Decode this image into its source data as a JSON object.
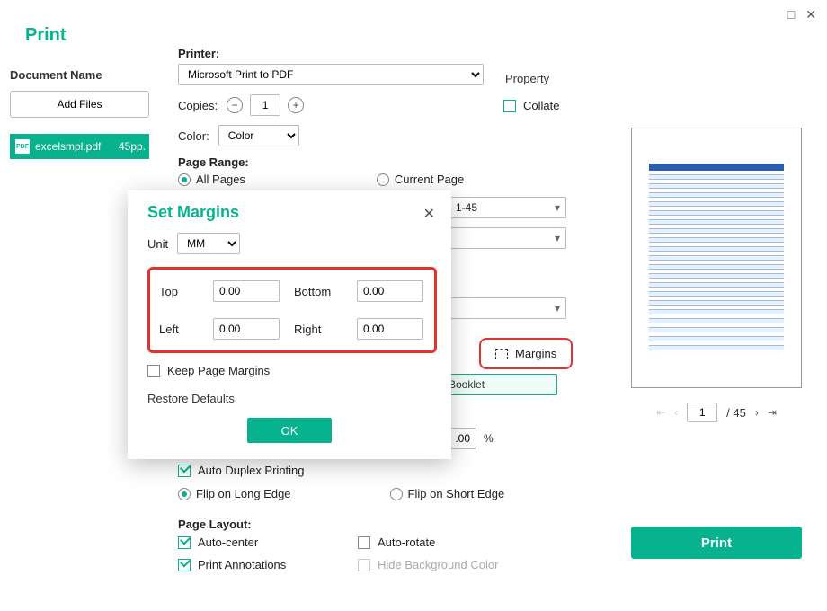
{
  "window": {
    "title": "Print",
    "maximize_glyph": "□",
    "close_glyph": "✕"
  },
  "sidebar": {
    "document_name_label": "Document Name",
    "add_files_label": "Add Files",
    "file": {
      "badge": "PDF",
      "name": "excelsmpl.pdf",
      "pages_label": "45pp."
    }
  },
  "printer": {
    "label": "Printer:",
    "selected": "Microsoft Print to PDF",
    "property_label": "Property"
  },
  "copies": {
    "label": "Copies:",
    "value": "1",
    "collate_label": "Collate",
    "collate_checked": false
  },
  "color": {
    "label": "Color:",
    "selected": "Color"
  },
  "page_range": {
    "label": "Page Range:",
    "all_pages": "All Pages",
    "current_page": "Current Page",
    "range_value": "1-45"
  },
  "margins_button_label": "Margins",
  "booklet_label": "Booklet",
  "scale_percent": ".00",
  "scale_unit": "%",
  "duplex": {
    "auto_duplex_label": "Auto Duplex Printing",
    "flip_long_label": "Flip on Long Edge",
    "flip_short_label": "Flip on Short Edge"
  },
  "layout": {
    "section_label": "Page Layout:",
    "auto_center": "Auto-center",
    "auto_rotate": "Auto-rotate",
    "print_annotations": "Print Annotations",
    "hide_bg": "Hide Background Color"
  },
  "modal": {
    "title": "Set Margins",
    "unit_label": "Unit",
    "unit_value": "MM",
    "top_label": "Top",
    "bottom_label": "Bottom",
    "left_label": "Left",
    "right_label": "Right",
    "top_value": "0.00",
    "bottom_value": "0.00",
    "left_value": "0.00",
    "right_value": "0.00",
    "keep_page_margins": "Keep Page Margins",
    "restore_defaults": "Restore Defaults",
    "ok_label": "OK"
  },
  "pager": {
    "current": "1",
    "total": "/ 45"
  },
  "print_button_label": "Print"
}
